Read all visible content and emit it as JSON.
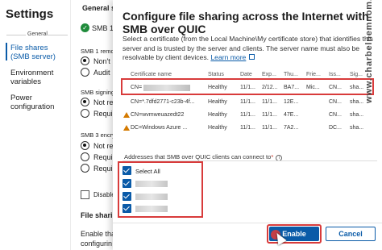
{
  "nav": {
    "title": "Settings",
    "group_label": "General",
    "items": [
      {
        "label": "File shares (SMB server)",
        "selected": true
      },
      {
        "label": "Environment variables",
        "selected": false
      },
      {
        "label": "Power configuration",
        "selected": false
      }
    ]
  },
  "middle": {
    "general_settings": "General s",
    "smb1": "SMB 1",
    "smb1_removal": "SMB 1 remov",
    "opt_nont": "Non't",
    "opt_audit": "Audit",
    "signing_label": "SMB signing",
    "opt_not_req": "Not re",
    "opt_required": "Requi",
    "smb3_label": "SMB 3 encry",
    "opt_not_req2": "Not re",
    "opt_required2": "Requi",
    "opt_required3": "Requi",
    "disable_label": "Disable",
    "file_sharing": "File sharin",
    "enable_the": "Enable tha",
    "configuring": "configurin"
  },
  "dialog": {
    "title": "Configure file sharing across the Internet with SMB over QUIC",
    "description": "Select a certificate (from the Local Machine\\My certificate store) that identifies this server and is trusted by the server and clients. The server name must also be resolvable by client devices.",
    "learn_more": "Learn more",
    "columns": [
      "Certificate name",
      "Status",
      "Date",
      "Exp...",
      "Thu...",
      "Frie...",
      "Iss...",
      "Sig..."
    ],
    "rows": [
      {
        "name": "CN=",
        "status": "Healthy",
        "date": "11/1...",
        "exp": "2/12...",
        "thumb": "BA7...",
        "friendly": "Mic...",
        "issuer": "CN...",
        "sig": "sha...",
        "warning": false
      },
      {
        "name": "CN=*.7dfd2771-c23b-4f...",
        "status": "Healthy",
        "date": "11/1...",
        "exp": "11/1...",
        "thumb": "12E...",
        "friendly": "",
        "issuer": "CN...",
        "sig": "sha...",
        "warning": false
      },
      {
        "name": "CN=wvmweuazedt22",
        "status": "Healthy",
        "date": "11/1...",
        "exp": "11/1...",
        "thumb": "47E...",
        "friendly": "",
        "issuer": "CN...",
        "sig": "sha...",
        "warning": true
      },
      {
        "name": "DC=Windows Azure ...",
        "status": "Healthy",
        "date": "11/1...",
        "exp": "11/1...",
        "thumb": "7A2...",
        "friendly": "",
        "issuer": "DC...",
        "sig": "sha...",
        "warning": true
      }
    ],
    "addresses_label": "Addresses that SMB over QUIC clients can connect to",
    "select_all": "Select All",
    "enable_button": "Enable",
    "cancel_button": "Cancel"
  },
  "watermark": "www.charbelnemnom.com",
  "colors": {
    "accent": "#0a5ba8",
    "highlight": "#d83b3b",
    "healthy_green": "#1f8b3b",
    "warning": "#d47a00"
  }
}
